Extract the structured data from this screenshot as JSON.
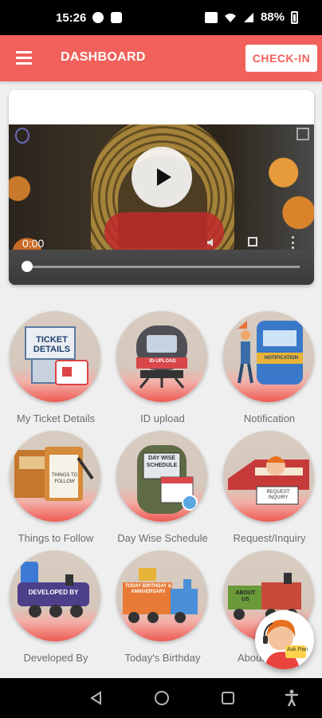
{
  "status_bar": {
    "time": "15:26",
    "battery": "88%"
  },
  "app_bar": {
    "title": "DASHBOARD",
    "checkin_label": "CHECK-IN"
  },
  "video": {
    "timecode": "0:00",
    "progress": 0
  },
  "tiles": [
    {
      "label": "My Ticket Details",
      "icon": "ticket-details-icon",
      "art_text": "TICKET DETAILS"
    },
    {
      "label": "ID upload",
      "icon": "id-upload-train-icon",
      "art_text": "ID-UPLOAD"
    },
    {
      "label": "Notification",
      "icon": "notification-train-icon",
      "art_text": "NOTIFICATION"
    },
    {
      "label": "Things to Follow",
      "icon": "things-to-follow-icon",
      "art_text": "THINGS TO FOLLOW"
    },
    {
      "label": "Day Wise Schedule",
      "icon": "day-wise-schedule-icon",
      "art_text": "DAY WISE SCHEDULE"
    },
    {
      "label": "Request/Inquiry",
      "icon": "request-inquiry-icon",
      "art_text": "REQUEST INQUIRY"
    },
    {
      "label": "Developed By",
      "icon": "developed-by-train-icon",
      "art_text": "DEVELOPED BY"
    },
    {
      "label": "Today's Birthday",
      "icon": "birthday-train-icon",
      "art_text": "TODAY BIRTHDAY & ANNIVERSARY"
    },
    {
      "label": "About Us",
      "icon": "about-us-train-icon",
      "art_text": "ABOUT US"
    }
  ],
  "fab": {
    "label": "Ask Pari",
    "icon": "assistant-avatar-icon"
  },
  "colors": {
    "accent": "#f1605a",
    "label_gray": "#6d6d6d",
    "background": "#efefef"
  }
}
